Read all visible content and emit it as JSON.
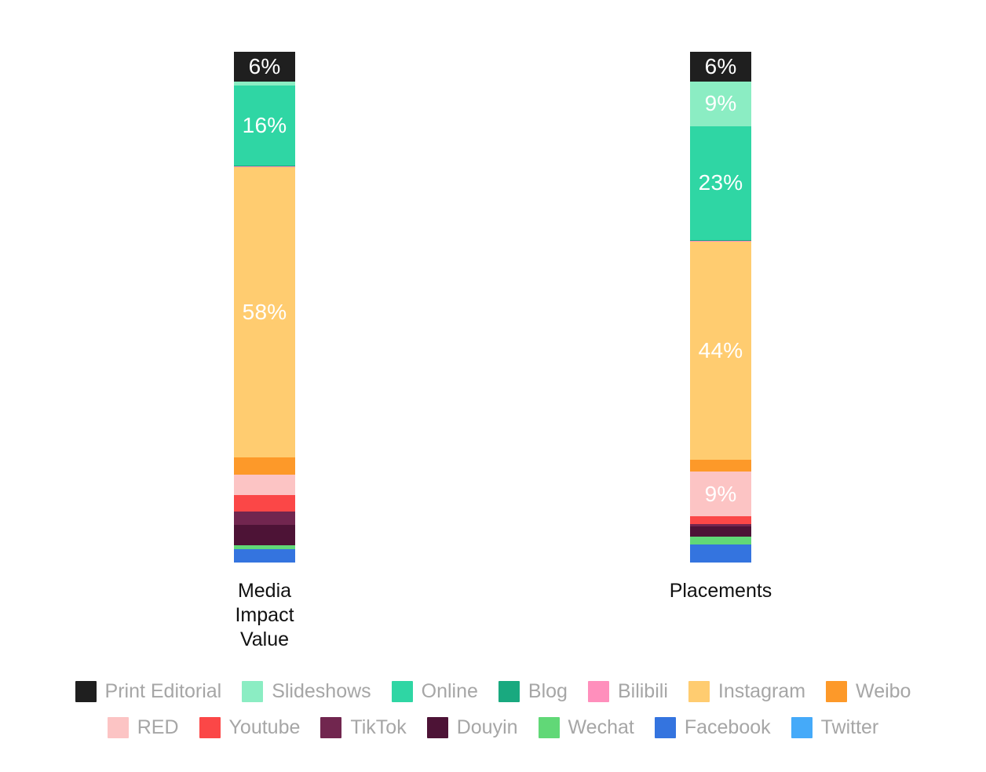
{
  "chart_data": {
    "type": "bar",
    "subtype": "stacked-100-percent",
    "title": "",
    "subtitle": "",
    "xlabel": "",
    "ylabel": "",
    "ylim": [
      0,
      100
    ],
    "grid": false,
    "legend_position": "bottom",
    "stack_order_top_to_bottom": [
      "Print Editorial",
      "Slideshows",
      "Online",
      "Blog",
      "Bilibili",
      "Instagram",
      "Weibo",
      "RED",
      "Youtube",
      "TikTok",
      "Douyin",
      "Wechat",
      "Facebook",
      "Twitter"
    ],
    "categories": [
      "Media Impact Value",
      "Placements"
    ],
    "category_display": [
      [
        "Media",
        "Impact",
        "Value"
      ],
      [
        "Placements"
      ]
    ],
    "series": [
      {
        "name": "Print Editorial",
        "color": "#1f1f1f",
        "values": [
          6,
          6
        ]
      },
      {
        "name": "Slideshows",
        "color": "#8bedc3",
        "values": [
          0.7,
          9
        ]
      },
      {
        "name": "Online",
        "color": "#2fd6a4",
        "values": [
          16,
          23
        ]
      },
      {
        "name": "Blog",
        "color": "#19a97f",
        "values": [
          0.2,
          0.2
        ]
      },
      {
        "name": "Bilibili",
        "color": "#ff8fbc",
        "values": [
          0.2,
          0.2
        ]
      },
      {
        "name": "Instagram",
        "color": "#ffcc70",
        "values": [
          58,
          44
        ]
      },
      {
        "name": "Weibo",
        "color": "#fd9929",
        "values": [
          3.4,
          2.4
        ]
      },
      {
        "name": "RED",
        "color": "#fcc4c4",
        "values": [
          4.1,
          9
        ]
      },
      {
        "name": "Youtube",
        "color": "#fb4747",
        "values": [
          3.4,
          1.5
        ]
      },
      {
        "name": "TikTok",
        "color": "#71264f",
        "values": [
          2.6,
          0.6
        ]
      },
      {
        "name": "Douyin",
        "color": "#4d1336",
        "values": [
          4.0,
          2.0
        ]
      },
      {
        "name": "Wechat",
        "color": "#61d877",
        "values": [
          0.8,
          1.6
        ]
      },
      {
        "name": "Facebook",
        "color": "#3474df",
        "values": [
          2.9,
          3.6
        ]
      },
      {
        "name": "Twitter",
        "color": "#45aaf9",
        "values": [
          0.0,
          0.0
        ]
      }
    ],
    "data_labels": {
      "Media Impact Value": [
        {
          "segment": "Print Editorial",
          "text": "6%"
        },
        {
          "segment": "Online",
          "text": "16%"
        },
        {
          "segment": "Instagram",
          "text": "58%"
        }
      ],
      "Placements": [
        {
          "segment": "Print Editorial",
          "text": "6%"
        },
        {
          "segment": "Slideshows",
          "text": "9%"
        },
        {
          "segment": "Online",
          "text": "23%"
        },
        {
          "segment": "Instagram",
          "text": "44%"
        },
        {
          "segment": "RED",
          "text": "9%"
        }
      ]
    }
  },
  "bars": [
    {
      "category_lines": [
        "Media",
        "Impact",
        "Value"
      ],
      "segments": [
        {
          "name": "Print Editorial",
          "color": "#1f1f1f",
          "pct": 6.0,
          "label": "6%"
        },
        {
          "name": "Slideshows",
          "color": "#8bedc3",
          "pct": 0.7,
          "label": ""
        },
        {
          "name": "Online",
          "color": "#2fd6a4",
          "pct": 16.0,
          "label": "16%"
        },
        {
          "name": "Blog",
          "color": "#19a97f",
          "pct": 0.15,
          "label": ""
        },
        {
          "name": "Bilibili",
          "color": "#ff8fbc",
          "pct": 0.15,
          "label": ""
        },
        {
          "name": "Instagram",
          "color": "#ffcc70",
          "pct": 58.0,
          "label": "58%"
        },
        {
          "name": "Weibo",
          "color": "#fd9929",
          "pct": 3.4,
          "label": ""
        },
        {
          "name": "RED",
          "color": "#fcc4c4",
          "pct": 4.1,
          "label": ""
        },
        {
          "name": "Youtube",
          "color": "#fb4747",
          "pct": 3.4,
          "label": ""
        },
        {
          "name": "TikTok",
          "color": "#71264f",
          "pct": 2.6,
          "label": ""
        },
        {
          "name": "Douyin",
          "color": "#4d1336",
          "pct": 4.0,
          "label": ""
        },
        {
          "name": "Wechat",
          "color": "#61d877",
          "pct": 0.8,
          "label": ""
        },
        {
          "name": "Facebook",
          "color": "#3474df",
          "pct": 2.7,
          "label": ""
        }
      ]
    },
    {
      "category_lines": [
        "Placements"
      ],
      "segments": [
        {
          "name": "Print Editorial",
          "color": "#1f1f1f",
          "pct": 6.0,
          "label": "6%"
        },
        {
          "name": "Slideshows",
          "color": "#8bedc3",
          "pct": 9.0,
          "label": "9%"
        },
        {
          "name": "Online",
          "color": "#2fd6a4",
          "pct": 23.0,
          "label": "23%"
        },
        {
          "name": "Blog",
          "color": "#19a97f",
          "pct": 0.15,
          "label": ""
        },
        {
          "name": "Bilibili",
          "color": "#ff8fbc",
          "pct": 0.15,
          "label": ""
        },
        {
          "name": "Instagram",
          "color": "#ffcc70",
          "pct": 44.0,
          "label": "44%"
        },
        {
          "name": "Weibo",
          "color": "#fd9929",
          "pct": 2.4,
          "label": ""
        },
        {
          "name": "RED",
          "color": "#fcc4c4",
          "pct": 9.0,
          "label": "9%"
        },
        {
          "name": "Youtube",
          "color": "#fb4747",
          "pct": 1.5,
          "label": ""
        },
        {
          "name": "TikTok",
          "color": "#71264f",
          "pct": 0.6,
          "label": ""
        },
        {
          "name": "Douyin",
          "color": "#4d1336",
          "pct": 2.0,
          "label": ""
        },
        {
          "name": "Wechat",
          "color": "#61d877",
          "pct": 1.6,
          "label": ""
        },
        {
          "name": "Facebook",
          "color": "#3474df",
          "pct": 3.6,
          "label": ""
        }
      ]
    }
  ],
  "legend": {
    "rows": [
      [
        {
          "label": "Print Editorial",
          "color": "#1f1f1f"
        },
        {
          "label": "Slideshows",
          "color": "#8bedc3"
        },
        {
          "label": "Online",
          "color": "#2fd6a4"
        },
        {
          "label": "Blog",
          "color": "#19a97f"
        },
        {
          "label": "Bilibili",
          "color": "#ff8fbc"
        },
        {
          "label": "Instagram",
          "color": "#ffcc70"
        },
        {
          "label": "Weibo",
          "color": "#fd9929"
        }
      ],
      [
        {
          "label": "RED",
          "color": "#fcc4c4"
        },
        {
          "label": "Youtube",
          "color": "#fb4747"
        },
        {
          "label": "TikTok",
          "color": "#71264f"
        },
        {
          "label": "Douyin",
          "color": "#4d1336"
        },
        {
          "label": "Wechat",
          "color": "#61d877"
        },
        {
          "label": "Facebook",
          "color": "#3474df"
        },
        {
          "label": "Twitter",
          "color": "#45aaf9"
        }
      ]
    ],
    "text_color": "#a6a6a6"
  },
  "colors": {
    "background": "#ffffff",
    "category_label": "#111111",
    "data_label": "#ffffff",
    "legend_label": "#a6a6a6"
  }
}
